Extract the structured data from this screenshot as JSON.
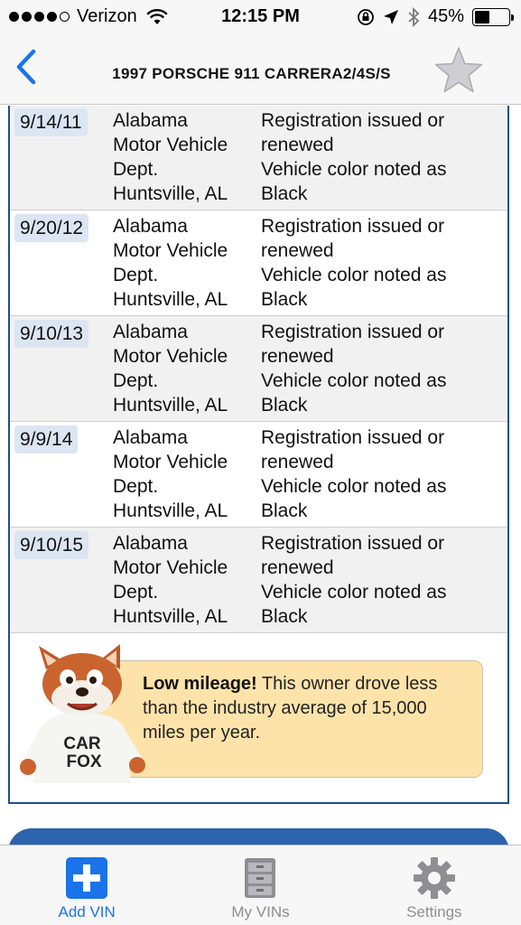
{
  "status_bar": {
    "carrier": "Verizon",
    "time": "12:15 PM",
    "battery": "45%",
    "battery_level": 0.45,
    "icons": [
      "signal-dots-icon",
      "wifi-icon",
      "orientation-lock-icon",
      "location-arrow-icon",
      "bluetooth-icon",
      "battery-icon"
    ]
  },
  "nav": {
    "title": "1997 PORSCHE 911 CARRERA2/4S/S",
    "back_icon": "chevron-left-icon",
    "favorite_icon": "star-icon"
  },
  "history": [
    {
      "date": "9/14/11",
      "source": [
        "Alabama",
        "Motor Vehicle",
        "Dept.",
        "Huntsville, AL"
      ],
      "comments": [
        "Registration issued or",
        "renewed",
        "Vehicle color noted as",
        "Black"
      ]
    },
    {
      "date": "9/20/12",
      "source": [
        "Alabama",
        "Motor Vehicle",
        "Dept.",
        "Huntsville, AL"
      ],
      "comments": [
        "Registration issued or",
        "renewed",
        "Vehicle color noted as",
        "Black"
      ]
    },
    {
      "date": "9/10/13",
      "source": [
        "Alabama",
        "Motor Vehicle",
        "Dept.",
        "Huntsville, AL"
      ],
      "comments": [
        "Registration issued or",
        "renewed",
        "Vehicle color noted as",
        "Black"
      ]
    },
    {
      "date": "9/9/14",
      "source": [
        "Alabama",
        "Motor Vehicle",
        "Dept.",
        "Huntsville, AL"
      ],
      "comments": [
        "Registration issued or",
        "renewed",
        "Vehicle color noted as",
        "Black"
      ]
    },
    {
      "date": "9/10/15",
      "source": [
        "Alabama",
        "Motor Vehicle",
        "Dept.",
        "Huntsville, AL"
      ],
      "comments": [
        "Registration issued or",
        "renewed",
        "Vehicle color noted as",
        "Black"
      ]
    }
  ],
  "mileage": {
    "headline": "Low mileage!",
    "line1": " This owner drove less",
    "line2": "than the industry average of 15,000",
    "line3": "miles per year.",
    "fox_shirt_line1": "CAR",
    "fox_shirt_line2": "FOX"
  },
  "tabs": [
    {
      "label": "Add VIN",
      "icon": "plus-icon",
      "active": true
    },
    {
      "label": "My VINs",
      "icon": "file-cabinet-icon",
      "active": false
    },
    {
      "label": "Settings",
      "icon": "gear-icon",
      "active": false
    }
  ],
  "colors": {
    "accent": "#1a73e8",
    "border_blue": "#1f4e8c",
    "date_badge": "#dce5f2",
    "callout_bg": "#fde3aa",
    "tab_inactive": "#8e8e93"
  }
}
